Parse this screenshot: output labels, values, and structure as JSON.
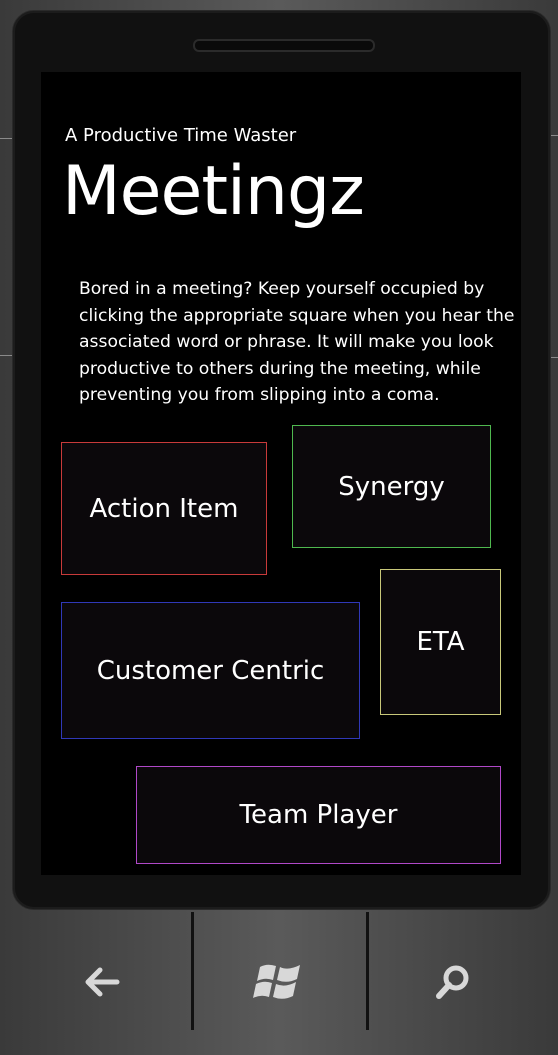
{
  "app": {
    "subtitle": "A Productive Time Waster",
    "title": "Meetingz",
    "description": "Bored in a meeting?  Keep yourself occupied by clicking the appropriate square when you hear the associated word or phrase.  It will make you look productive to others during the meeting, while preventing you from slipping into a coma."
  },
  "tiles": [
    {
      "label": "Action Item",
      "color": "#c83a3a"
    },
    {
      "label": "Synergy",
      "color": "#4fb84f"
    },
    {
      "label": "ETA",
      "color": "#c8c87a"
    },
    {
      "label": "Customer Centric",
      "color": "#3038b8"
    },
    {
      "label": "Team Player",
      "color": "#b048c8"
    }
  ],
  "hardware_buttons": [
    {
      "name": "back",
      "icon": "back-arrow-icon"
    },
    {
      "name": "start",
      "icon": "windows-logo-icon"
    },
    {
      "name": "search",
      "icon": "search-icon"
    }
  ]
}
